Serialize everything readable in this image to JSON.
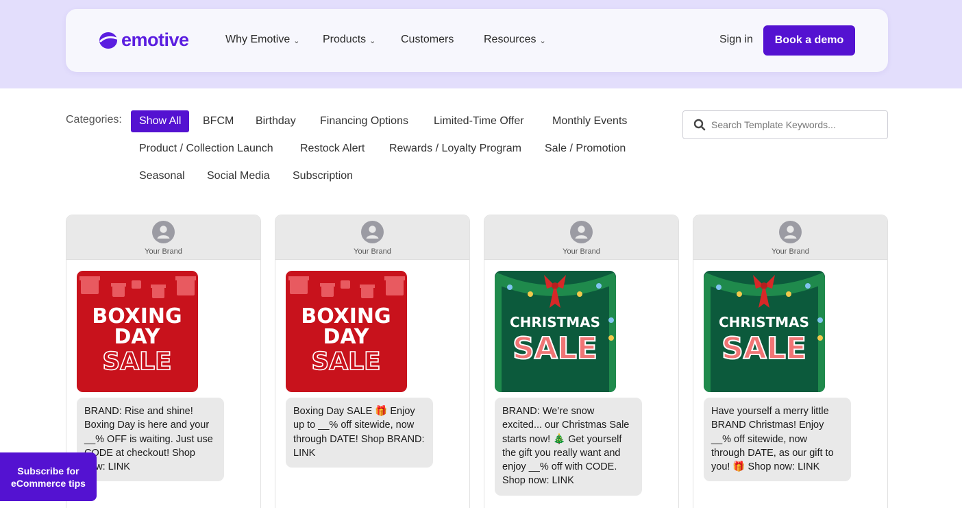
{
  "brand": {
    "logo_text": "emotive",
    "logo_icon": "emotive-logo-icon"
  },
  "nav": {
    "items": [
      {
        "label": "Why Emotive",
        "dropdown": true
      },
      {
        "label": "Products",
        "dropdown": true
      },
      {
        "label": "Customers",
        "dropdown": false
      },
      {
        "label": "Resources",
        "dropdown": true
      }
    ],
    "signin_label": "Sign in",
    "demo_label": "Book a demo",
    "chevron_glyph": "⌄"
  },
  "categories": {
    "label": "Categories:",
    "items": [
      "Show All",
      "BFCM",
      "Birthday",
      "Financing Options",
      "Limited-Time Offer",
      "Monthly Events",
      "Product / Collection Launch",
      "Restock Alert",
      "Rewards / Loyalty Program",
      "Sale / Promotion",
      "Seasonal",
      "Social Media",
      "Subscription"
    ],
    "active": "Show All"
  },
  "search": {
    "placeholder": "Search Template Keywords...",
    "value": "",
    "icon": "search-icon"
  },
  "cards": [
    {
      "sender": "Your Brand",
      "image": {
        "line1": "BOXING",
        "line2": "DAY",
        "line3": "SALE"
      },
      "message": "BRAND: Rise and shine! Boxing Day is here and your __% OFF is waiting. Just use CODE at checkout! Shop now: LINK"
    },
    {
      "sender": "Your Brand",
      "image": {
        "line1": "BOXING",
        "line2": "DAY",
        "line3": "SALE"
      },
      "message": "Boxing Day SALE 🎁 Enjoy up to __% off sitewide, now through DATE! Shop BRAND: LINK"
    },
    {
      "sender": "Your Brand",
      "image": {
        "line1": "CHRISTMAS",
        "line2": "SALE"
      },
      "message": "BRAND: We’re snow excited... our Christmas Sale starts now! 🎄 Get yourself the gift you really want and enjoy __% off with CODE. Shop now: LINK"
    },
    {
      "sender": "Your Brand",
      "image": {
        "line1": "CHRISTMAS",
        "line2": "SALE"
      },
      "message": "Have yourself a merry little BRAND Christmas! Enjoy __% off sitewide, now through DATE, as our gift to you! 🎁 Shop now: LINK"
    }
  ],
  "subscribe": {
    "label": "Subscribe for eCommerce tips"
  },
  "colors": {
    "accent": "#5412d1",
    "hero_band": "#e3defc",
    "boxing_red": "#c8121c",
    "christmas_green": "#0c5a3c",
    "bubble_gray": "#e9e9e9"
  }
}
